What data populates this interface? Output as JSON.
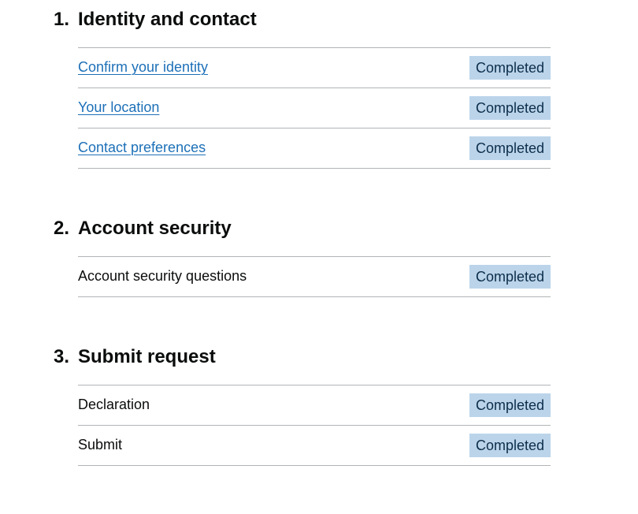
{
  "sections": [
    {
      "number": "1.",
      "title": "Identity and contact",
      "items": [
        {
          "label": "Confirm your identity",
          "link": true,
          "status": "Completed"
        },
        {
          "label": "Your location",
          "link": true,
          "status": "Completed"
        },
        {
          "label": "Contact preferences",
          "link": true,
          "status": "Completed"
        }
      ]
    },
    {
      "number": "2.",
      "title": "Account security",
      "items": [
        {
          "label": "Account security questions",
          "link": false,
          "status": "Completed"
        }
      ]
    },
    {
      "number": "3.",
      "title": "Submit request",
      "items": [
        {
          "label": "Declaration",
          "link": false,
          "status": "Completed"
        },
        {
          "label": "Submit",
          "link": false,
          "status": "Completed"
        }
      ]
    }
  ],
  "colors": {
    "link": "#1d70b8",
    "tag_background": "#bbd4ea",
    "tag_text": "#0c2d4a",
    "divider": "#b1b4b6"
  }
}
